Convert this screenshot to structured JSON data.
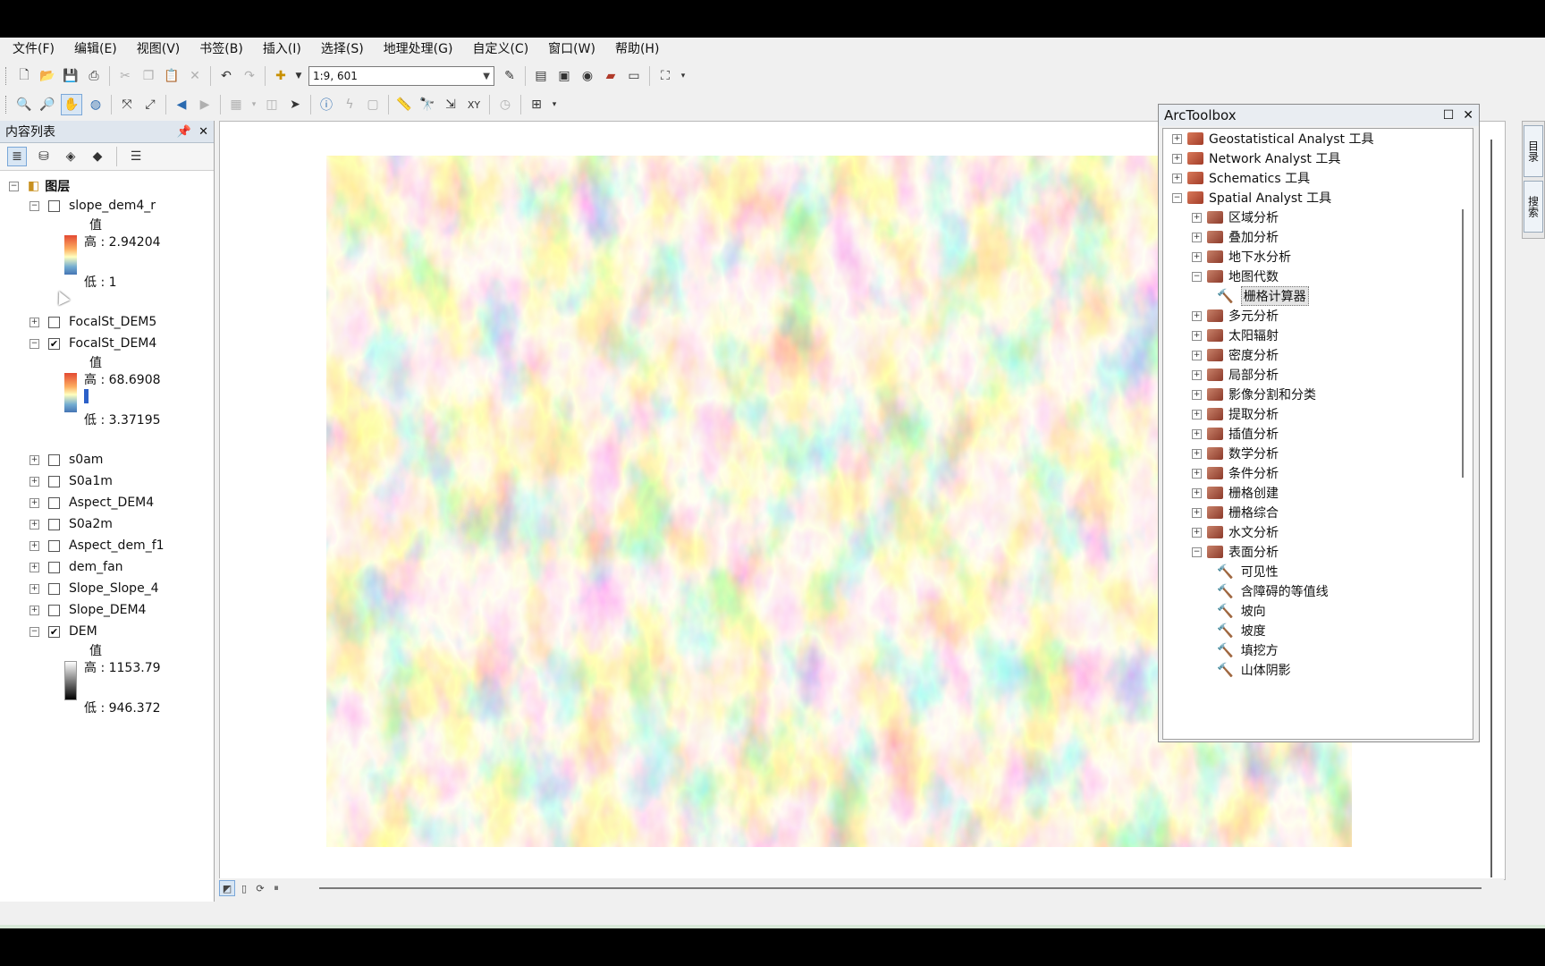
{
  "menu": [
    "文件(F)",
    "编辑(E)",
    "视图(V)",
    "书签(B)",
    "插入(I)",
    "选择(S)",
    "地理处理(G)",
    "自定义(C)",
    "窗口(W)",
    "帮助(H)"
  ],
  "toolbar": {
    "scale": "1:9, 601",
    "icons1": [
      "new-icon",
      "open-icon",
      "save-icon",
      "print-icon",
      "cut-icon",
      "copy-icon",
      "paste-icon",
      "delete-icon",
      "undo-icon",
      "redo-icon",
      "add-data-icon"
    ],
    "icons2": [
      "zoom-in-icon",
      "zoom-out-icon",
      "pan-icon",
      "globe-icon",
      "full-extent-icon",
      "fixed-zoom-icon",
      "back-icon",
      "forward-icon",
      "select-icon",
      "identify-icon",
      "find-icon",
      "measure-icon"
    ]
  },
  "toc": {
    "title": "内容列表",
    "root_label": "图层",
    "layers": [
      {
        "name": "slope_dem4_r",
        "checked": false,
        "expanded": true,
        "legend": {
          "title": "值",
          "high": "高 : 2.94204",
          "low": "低 : 1"
        }
      },
      {
        "name": "FocalSt_DEM5",
        "checked": false,
        "expanded": false
      },
      {
        "name": "FocalSt_DEM4",
        "checked": true,
        "expanded": true,
        "legend": {
          "title": "值",
          "high": "高 : 68.6908",
          "low": "低 : 3.37195"
        }
      },
      {
        "name": "s0am",
        "checked": false,
        "expanded": false
      },
      {
        "name": "S0a1m",
        "checked": false,
        "expanded": false
      },
      {
        "name": "Aspect_DEM4",
        "checked": false,
        "expanded": false
      },
      {
        "name": "S0a2m",
        "checked": false,
        "expanded": false
      },
      {
        "name": "Aspect_dem_f1",
        "checked": false,
        "expanded": false
      },
      {
        "name": "dem_fan",
        "checked": false,
        "expanded": false
      },
      {
        "name": "Slope_Slope_4",
        "checked": false,
        "expanded": false
      },
      {
        "name": "Slope_DEM4",
        "checked": false,
        "expanded": false
      },
      {
        "name": "DEM",
        "checked": true,
        "expanded": true,
        "legend": {
          "title": "值",
          "high": "高 : 1153.79",
          "low": "低 : 946.372"
        }
      }
    ]
  },
  "arctoolbox": {
    "title": "ArcToolbox",
    "items": [
      {
        "label": "Geostatistical Analyst 工具",
        "kind": "toolbox",
        "expander": "+"
      },
      {
        "label": "Network Analyst 工具",
        "kind": "toolbox",
        "expander": "+"
      },
      {
        "label": "Schematics 工具",
        "kind": "toolbox",
        "expander": "+"
      },
      {
        "label": "Spatial Analyst 工具",
        "kind": "toolbox",
        "expander": "−"
      },
      {
        "label": "区域分析",
        "kind": "toolset",
        "expander": "+"
      },
      {
        "label": "叠加分析",
        "kind": "toolset",
        "expander": "+"
      },
      {
        "label": "地下水分析",
        "kind": "toolset",
        "expander": "+"
      },
      {
        "label": "地图代数",
        "kind": "toolset",
        "expander": "−"
      },
      {
        "label": "栅格计算器",
        "kind": "tool",
        "selected": true
      },
      {
        "label": "多元分析",
        "kind": "toolset",
        "expander": "+"
      },
      {
        "label": "太阳辐射",
        "kind": "toolset",
        "expander": "+"
      },
      {
        "label": "密度分析",
        "kind": "toolset",
        "expander": "+"
      },
      {
        "label": "局部分析",
        "kind": "toolset",
        "expander": "+"
      },
      {
        "label": "影像分割和分类",
        "kind": "toolset",
        "expander": "+"
      },
      {
        "label": "提取分析",
        "kind": "toolset",
        "expander": "+"
      },
      {
        "label": "插值分析",
        "kind": "toolset",
        "expander": "+"
      },
      {
        "label": "数学分析",
        "kind": "toolset",
        "expander": "+"
      },
      {
        "label": "条件分析",
        "kind": "toolset",
        "expander": "+"
      },
      {
        "label": "栅格创建",
        "kind": "toolset",
        "expander": "+"
      },
      {
        "label": "栅格综合",
        "kind": "toolset",
        "expander": "+"
      },
      {
        "label": "水文分析",
        "kind": "toolset",
        "expander": "+"
      },
      {
        "label": "表面分析",
        "kind": "toolset",
        "expander": "−"
      },
      {
        "label": "可见性",
        "kind": "tool"
      },
      {
        "label": "含障碍的等值线",
        "kind": "tool"
      },
      {
        "label": "坡向",
        "kind": "tool"
      },
      {
        "label": "坡度",
        "kind": "tool"
      },
      {
        "label": "填挖方",
        "kind": "tool"
      },
      {
        "label": "山体阴影",
        "kind": "tool"
      }
    ]
  },
  "right_dock": [
    "目录",
    "搜索"
  ],
  "colors": {
    "ramp_high": "#e34a33",
    "ramp_mid": "#ffffbf",
    "ramp_low": "#4575b4"
  }
}
